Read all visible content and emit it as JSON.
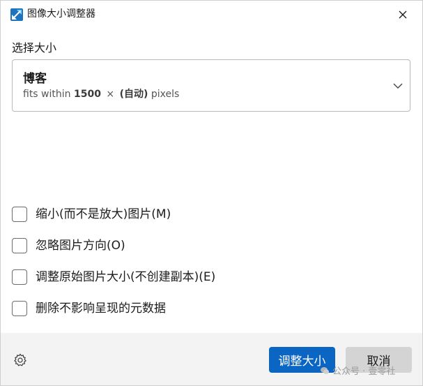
{
  "window": {
    "title": "图像大小调整器",
    "app_icon": "image-resizer-icon",
    "close_icon": "close-icon"
  },
  "size_section": {
    "label": "选择大小",
    "selected": {
      "name": "博客",
      "desc_prefix": "fits within",
      "width": "1500",
      "times": "×",
      "height": "(自动)",
      "unit": "pixels"
    },
    "dropdown_icon": "chevron-down-icon"
  },
  "options": [
    {
      "label": "缩小(而不是放大)图片(M)",
      "checked": false
    },
    {
      "label": "忽略图片方向(O)",
      "checked": false
    },
    {
      "label": "调整原始图片大小(不创建副本)(E)",
      "checked": false
    },
    {
      "label": "删除不影响呈现的元数据",
      "checked": false
    }
  ],
  "footer": {
    "settings_icon": "gear-icon",
    "resize_label": "调整大小",
    "cancel_label": "取消"
  },
  "watermark": {
    "text": "公众号 · 壹零社"
  },
  "colors": {
    "accent": "#0a66c2",
    "footer_bg": "#f3f3f3"
  }
}
